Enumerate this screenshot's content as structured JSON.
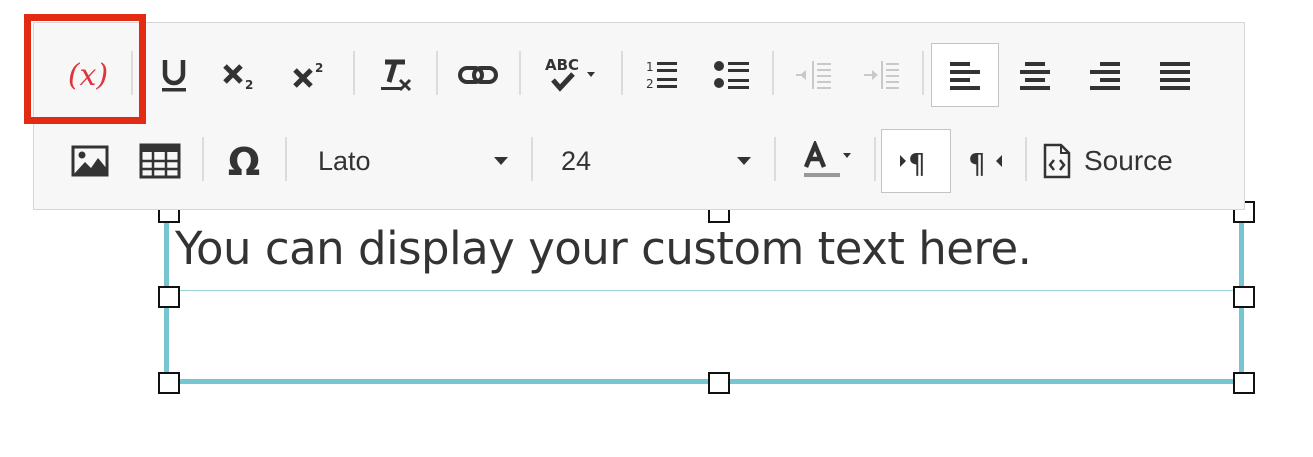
{
  "editor": {
    "content_text": "You can display your custom text here."
  },
  "toolbar": {
    "row1": [
      {
        "name": "insert-variable-button",
        "glyph": "(x)",
        "icon": "variable-icon"
      },
      {
        "name": "underline-button",
        "glyph": "U",
        "icon": "underline-icon"
      },
      {
        "name": "subscript-button",
        "glyph": "x₂",
        "icon": "subscript-icon"
      },
      {
        "name": "superscript-button",
        "glyph": "x²",
        "icon": "superscript-icon"
      },
      {
        "name": "remove-format-button",
        "glyph": "T",
        "icon": "remove-format-icon"
      },
      {
        "name": "link-button",
        "icon": "link-icon"
      },
      {
        "name": "spellcheck-button",
        "glyph": "ABC",
        "icon": "spellcheck-icon"
      },
      {
        "name": "numbered-list-button",
        "icon": "numbered-list-icon"
      },
      {
        "name": "bulleted-list-button",
        "icon": "bulleted-list-icon"
      },
      {
        "name": "decrease-indent-button",
        "icon": "outdent-icon"
      },
      {
        "name": "increase-indent-button",
        "icon": "indent-icon"
      },
      {
        "name": "align-left-button",
        "icon": "align-left-icon"
      },
      {
        "name": "align-center-button",
        "icon": "align-center-icon"
      },
      {
        "name": "align-right-button",
        "icon": "align-right-icon"
      },
      {
        "name": "justify-button",
        "icon": "justify-icon"
      }
    ],
    "font_family": {
      "selected": "Lato"
    },
    "font_size": {
      "selected": "24"
    },
    "source_label": "Source",
    "colors": {
      "highlight_border": "#e32b13",
      "variable_icon": "#e0343c",
      "selection_border": "#76c6d2"
    }
  }
}
